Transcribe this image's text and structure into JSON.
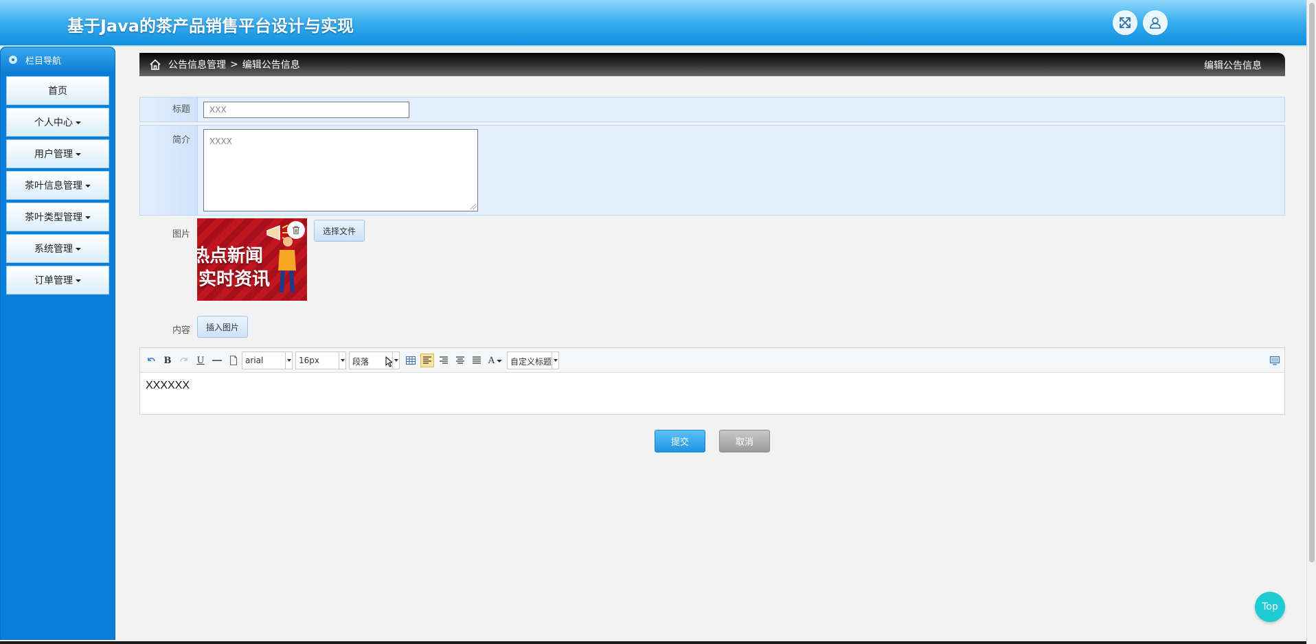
{
  "header": {
    "title": "基于Java的茶产品销售平台设计与实现"
  },
  "sidebar": {
    "title": "栏目导航",
    "items": [
      {
        "label": "首页",
        "has_caret": false
      },
      {
        "label": "个人中心",
        "has_caret": true
      },
      {
        "label": "用户管理",
        "has_caret": true
      },
      {
        "label": "茶叶信息管理",
        "has_caret": true
      },
      {
        "label": "茶叶类型管理",
        "has_caret": true
      },
      {
        "label": "系统管理",
        "has_caret": true
      },
      {
        "label": "订单管理",
        "has_caret": true
      }
    ]
  },
  "breadcrumb": {
    "parent": "公告信息管理",
    "separator": ">",
    "current": "编辑公告信息",
    "page_title": "编辑公告信息"
  },
  "form": {
    "title_label": "标题",
    "title_value": "XXX",
    "intro_label": "简介",
    "intro_value": "XXXX",
    "image_label": "图片",
    "image_preview_text_line1": "热点新闻",
    "image_preview_text_line2": "实时资讯",
    "choose_file_label": "选择文件",
    "content_label": "内容",
    "insert_image_label": "插入图片"
  },
  "editor": {
    "font_family": "arial",
    "font_size": "16px",
    "paragraph": "段落",
    "custom_title": "自定义标题",
    "bold_glyph": "B",
    "underline_glyph": "U",
    "font_color_glyph": "A",
    "content": "XXXXXX"
  },
  "actions": {
    "submit_label": "提交",
    "cancel_label": "取消"
  },
  "top_button": {
    "label": "Top"
  },
  "colors": {
    "sidebar_bg": "#0a7fd9",
    "submit_bg": "#1d95e2",
    "top_btn": "#1ccbd3"
  }
}
